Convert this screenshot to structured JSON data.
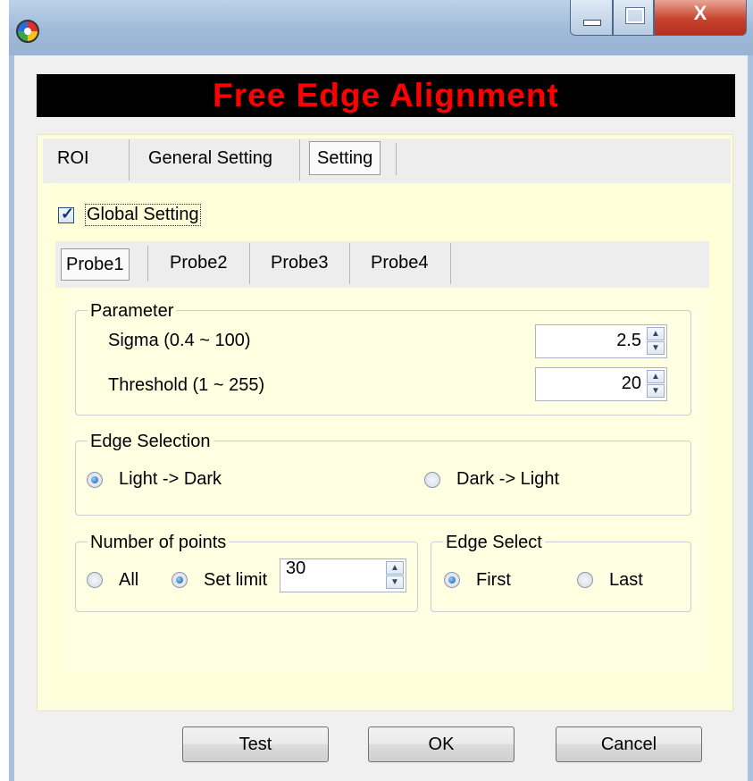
{
  "window": {
    "min_glyph": "",
    "max_glyph": "",
    "close_glyph": "X"
  },
  "banner": {
    "title": "Free Edge Alignment"
  },
  "outer_tabs": [
    "ROI",
    "General Setting",
    "Setting"
  ],
  "global_setting": {
    "label": "Global Setting",
    "checked": true
  },
  "probe_tabs": [
    "Probe1",
    "Probe2",
    "Probe3",
    "Probe4"
  ],
  "parameter": {
    "title": "Parameter",
    "sigma_label": "Sigma (0.4 ~ 100)",
    "sigma_value": "2.5",
    "threshold_label": "Threshold (1 ~ 255)",
    "threshold_value": "20"
  },
  "edge_selection": {
    "title": "Edge Selection",
    "option1": "Light -> Dark",
    "option2": "Dark -> Light",
    "selected": "Light -> Dark"
  },
  "number_of_points": {
    "title": "Number of points",
    "option_all": "All",
    "option_limit": "Set limit",
    "selected": "Set limit",
    "limit_value": "30"
  },
  "edge_select": {
    "title": "Edge Select",
    "option_first": "First",
    "option_last": "Last",
    "selected": "First"
  },
  "buttons": {
    "test": "Test",
    "ok": "OK",
    "cancel": "Cancel"
  }
}
